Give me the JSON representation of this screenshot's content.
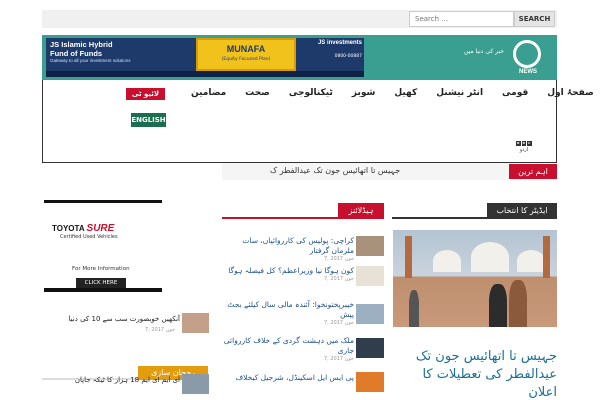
{
  "search": {
    "placeholder": "Search …",
    "button_label": "SEARCH"
  },
  "ad_banner": {
    "line1": "JS Islamic Hybrid",
    "line2": "Fund of Funds",
    "line3": "Gateway to all your investment solutions",
    "product": "MUNAFA",
    "product_sub": "(Equity Focused Plan)",
    "brand": "JS investments",
    "phone": "0800-00887"
  },
  "logo": {
    "word": "NEWS",
    "tagline": "خبر کی دنیا میں"
  },
  "nav": {
    "items": [
      "صفحۂ اول",
      "قومی",
      "انٹر نیشنل",
      "کھیل",
      "شوبز",
      "ٹیکنالوجی",
      "صحت",
      "مضامین"
    ],
    "live_tv_label": "لائیو ٹی وی",
    "english_label": "ENGLISH",
    "bbc_boxes": [
      "B",
      "B",
      "C"
    ],
    "bbc_urdu": "اردو"
  },
  "ticker": {
    "label": "اہم ترین",
    "text": "جہیس تا اتھائیس جون تک عیدالفطر ک"
  },
  "toyota_ad": {
    "brand": "TOYOTA",
    "brand_highlight": "SURE",
    "subtitle": "Certified Used Vehicles",
    "info": "For More Information",
    "cta": "CLICK HERE"
  },
  "trending": {
    "label": "رجحان سازی",
    "items": [
      {
        "title": "آنکھیں خوبصورت سب سے 10 کی دنیا",
        "date": "جون 2017 ,7"
      },
      {
        "title": "ای ایم ای ایم 18 ہزار کا ٹیکہ جاپان",
        "date": ""
      }
    ]
  },
  "headlines": {
    "label": "ہیڈلائنز",
    "items": [
      {
        "title": "کراچی: پولیس کی کارروائیاں، سات ملزمان گرفتار",
        "date": "جون 2017 ,7"
      },
      {
        "title": "کون ہوگا نیا وزیراعظم؟ کل فیصلہ ہوگا",
        "date": "جون 2017 ,7"
      },
      {
        "title": "خیبرپختونخوا: آئندہ مالی سال کیلئے بجٹ پیش",
        "date": "جون 2017 ,7"
      },
      {
        "title": "ملک میں دہشت گردی کے خلاف کارروائی جاری",
        "date": "جون 2017 ,7"
      },
      {
        "title": "پی ایس ایل اسکینڈل، شرجیل کیخلاف",
        "date": ""
      }
    ]
  },
  "editors_pick": {
    "label": "ایڈیٹر کا انتخاب",
    "headline": "جہیس تا اتھائیس جون تک عیدالفطر کی تعطیلات کا اعلان"
  },
  "colors": {
    "brand_teal": "#3a9f91",
    "live_red": "#c8102e",
    "english_green": "#1b6e4f",
    "trend_orange": "#e39c0d",
    "link_blue": "#1b6e96"
  }
}
